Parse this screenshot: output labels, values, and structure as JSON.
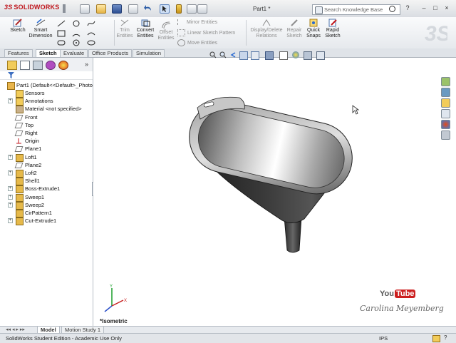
{
  "titlebar": {
    "app_name": "SOLIDWORKS",
    "document_title": "Part1 *",
    "search_placeholder": "Search Knowledge Base",
    "help_label": "?",
    "minimize": "–",
    "restore": "□",
    "close": "×"
  },
  "commands": {
    "sketch": "Sketch",
    "smart_dimension_1": "Smart",
    "smart_dimension_2": "Dimension",
    "trim_1": "Trim",
    "trim_2": "Entities",
    "convert_1": "Convert",
    "convert_2": "Entities",
    "offset_1": "Offset",
    "offset_2": "Entities",
    "mirror": "Mirror Entities",
    "linear_pattern": "Linear Sketch Pattern",
    "move": "Move Entities",
    "display_delete_1": "Display/Delete",
    "display_delete_2": "Relations",
    "repair_1": "Repair",
    "repair_2": "Sketch",
    "quick_snaps_1": "Quick",
    "quick_snaps_2": "Snaps",
    "rapid_1": "Rapid",
    "rapid_2": "Sketch"
  },
  "tabs": [
    "Features",
    "Sketch",
    "Evaluate",
    "Office Products",
    "Simulation"
  ],
  "active_tab": "Sketch",
  "tree": {
    "root": "Part1  (Default<<Default>_Photo",
    "items": [
      {
        "label": "Sensors",
        "icon": "sensor-icon",
        "expand": false
      },
      {
        "label": "Annotations",
        "icon": "annotation-icon",
        "expand": true
      },
      {
        "label": "Material <not specified>",
        "icon": "material-icon",
        "expand": false
      },
      {
        "label": "Front",
        "icon": "plane-icon",
        "expand": false
      },
      {
        "label": "Top",
        "icon": "plane-icon",
        "expand": false
      },
      {
        "label": "Right",
        "icon": "plane-icon",
        "expand": false
      },
      {
        "label": "Origin",
        "icon": "origin-icon",
        "expand": false
      },
      {
        "label": "Plane1",
        "icon": "plane-icon",
        "expand": false
      },
      {
        "label": "Loft1",
        "icon": "loft-icon",
        "expand": true
      },
      {
        "label": "Plane2",
        "icon": "plane-icon",
        "expand": false
      },
      {
        "label": "Loft2",
        "icon": "loft-icon",
        "expand": true
      },
      {
        "label": "Shell1",
        "icon": "shell-icon",
        "expand": false
      },
      {
        "label": "Boss-Extrude1",
        "icon": "extrude-icon",
        "expand": true
      },
      {
        "label": "Sweep1",
        "icon": "sweep-icon",
        "expand": true
      },
      {
        "label": "Sweep2",
        "icon": "sweep-icon",
        "expand": true
      },
      {
        "label": "CirPattern1",
        "icon": "pattern-icon",
        "expand": false
      },
      {
        "label": "Cut-Extrude1",
        "icon": "cut-icon",
        "expand": true
      }
    ]
  },
  "view": {
    "orientation": "*Isometric",
    "youtube_1": "You",
    "youtube_2": "Tube",
    "watermark": "Carolina Meyemberg"
  },
  "bottom_tabs": [
    "Model",
    "Motion Study 1"
  ],
  "status": {
    "text": "SolidWorks Student Edition - Academic Use Only",
    "units": "IPS",
    "help": "?"
  },
  "colors": {
    "accent": "#c0161c",
    "part_dark": "#2b2b2b",
    "part_light": "#e9e9e9",
    "tree_icon": "#d9a23a"
  }
}
